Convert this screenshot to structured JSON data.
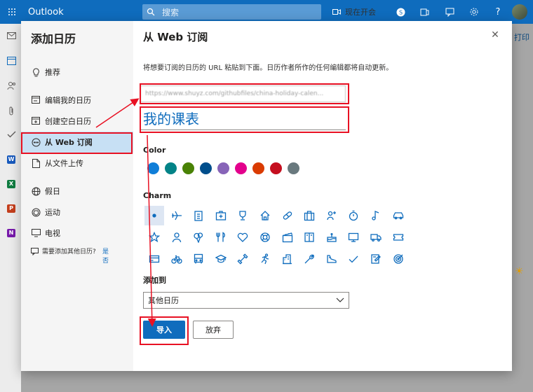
{
  "app": {
    "name": "Outlook",
    "search_placeholder": "搜索",
    "meet_now": "现在开会"
  },
  "background": {
    "print_label": "打印"
  },
  "dialog": {
    "title": "添加日历",
    "nav": [
      {
        "label": "推荐",
        "icon": "lightbulb-icon"
      },
      {
        "label": "编辑我的日历",
        "icon": "edit-calendar-icon"
      },
      {
        "label": "创建空白日历",
        "icon": "add-calendar-icon"
      },
      {
        "label": "从 Web 订阅",
        "icon": "web-subscribe-icon",
        "active": true
      },
      {
        "label": "从文件上传",
        "icon": "upload-file-icon"
      },
      {
        "label": "假日",
        "icon": "globe-icon"
      },
      {
        "label": "运动",
        "icon": "sports-ball-icon"
      },
      {
        "label": "电视",
        "icon": "tv-icon"
      }
    ],
    "footer": {
      "text": "需要添加其他日历?",
      "yes": "是否"
    },
    "main": {
      "title": "从 Web 订阅",
      "description": "将想要订阅的日历的 URL 粘贴到下面。日历作者所作的任何编辑都将自动更新。",
      "url_value": "https://www.shuyz.com/githubfiles/china-holiday-calen...",
      "name_value": "我的课表",
      "color_label": "Color",
      "colors": [
        "#0f7ed8",
        "#038387",
        "#498205",
        "#004e8c",
        "#8764b8",
        "#e3008c",
        "#da3b01",
        "#c50f1f",
        "#69797e"
      ],
      "charm_label": "Charm",
      "add_to_label": "添加到",
      "add_to_value": "其他日历",
      "import_label": "导入",
      "discard_label": "放弃"
    }
  }
}
